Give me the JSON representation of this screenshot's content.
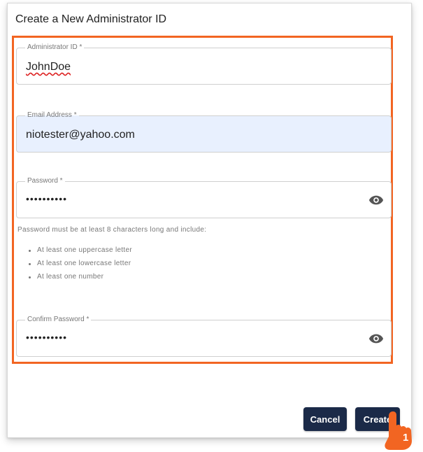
{
  "dialog": {
    "title": "Create a New Administrator ID"
  },
  "form": {
    "admin_id": {
      "label": "Administrator ID *",
      "value": "JohnDoe"
    },
    "email": {
      "label": "Email Address *",
      "value": "niotester@yahoo.com"
    },
    "password": {
      "label": "Password *",
      "value": "••••••••••"
    },
    "password_hint": "Password must be at least 8 characters long and include:",
    "requirements": [
      "At least one uppercase letter",
      "At least one lowercase letter",
      "At least one number"
    ],
    "confirm_password": {
      "label": "Confirm Password *",
      "value": "••••••••••"
    }
  },
  "actions": {
    "cancel_label": "Cancel",
    "create_label": "Create"
  },
  "annotation": {
    "step_number": "1",
    "highlight_color": "#f26522"
  },
  "icons": {
    "visibility": "eye-icon"
  },
  "colors": {
    "button": "#1b2a48",
    "autofill_bg": "#e8f0fe"
  }
}
